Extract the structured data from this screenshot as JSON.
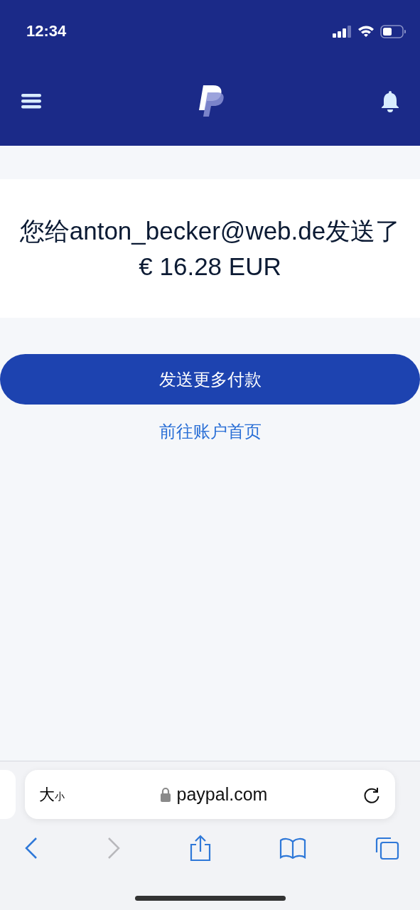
{
  "status_bar": {
    "time": "12:34"
  },
  "message": {
    "text": "您给anton_becker@web.de发送了€ 16.28 EUR"
  },
  "primary_button": {
    "label": "发送更多付款"
  },
  "link": {
    "label": "前往账户首页"
  },
  "browser": {
    "text_size": {
      "large": "大",
      "small": "小"
    },
    "url": "paypal.com",
    "toolbar": [
      {
        "kind": "back",
        "disabled": false
      },
      {
        "kind": "forward",
        "disabled": true
      },
      {
        "kind": "share",
        "disabled": false
      },
      {
        "kind": "bookmarks",
        "disabled": false
      },
      {
        "kind": "tabs",
        "disabled": false
      }
    ]
  }
}
